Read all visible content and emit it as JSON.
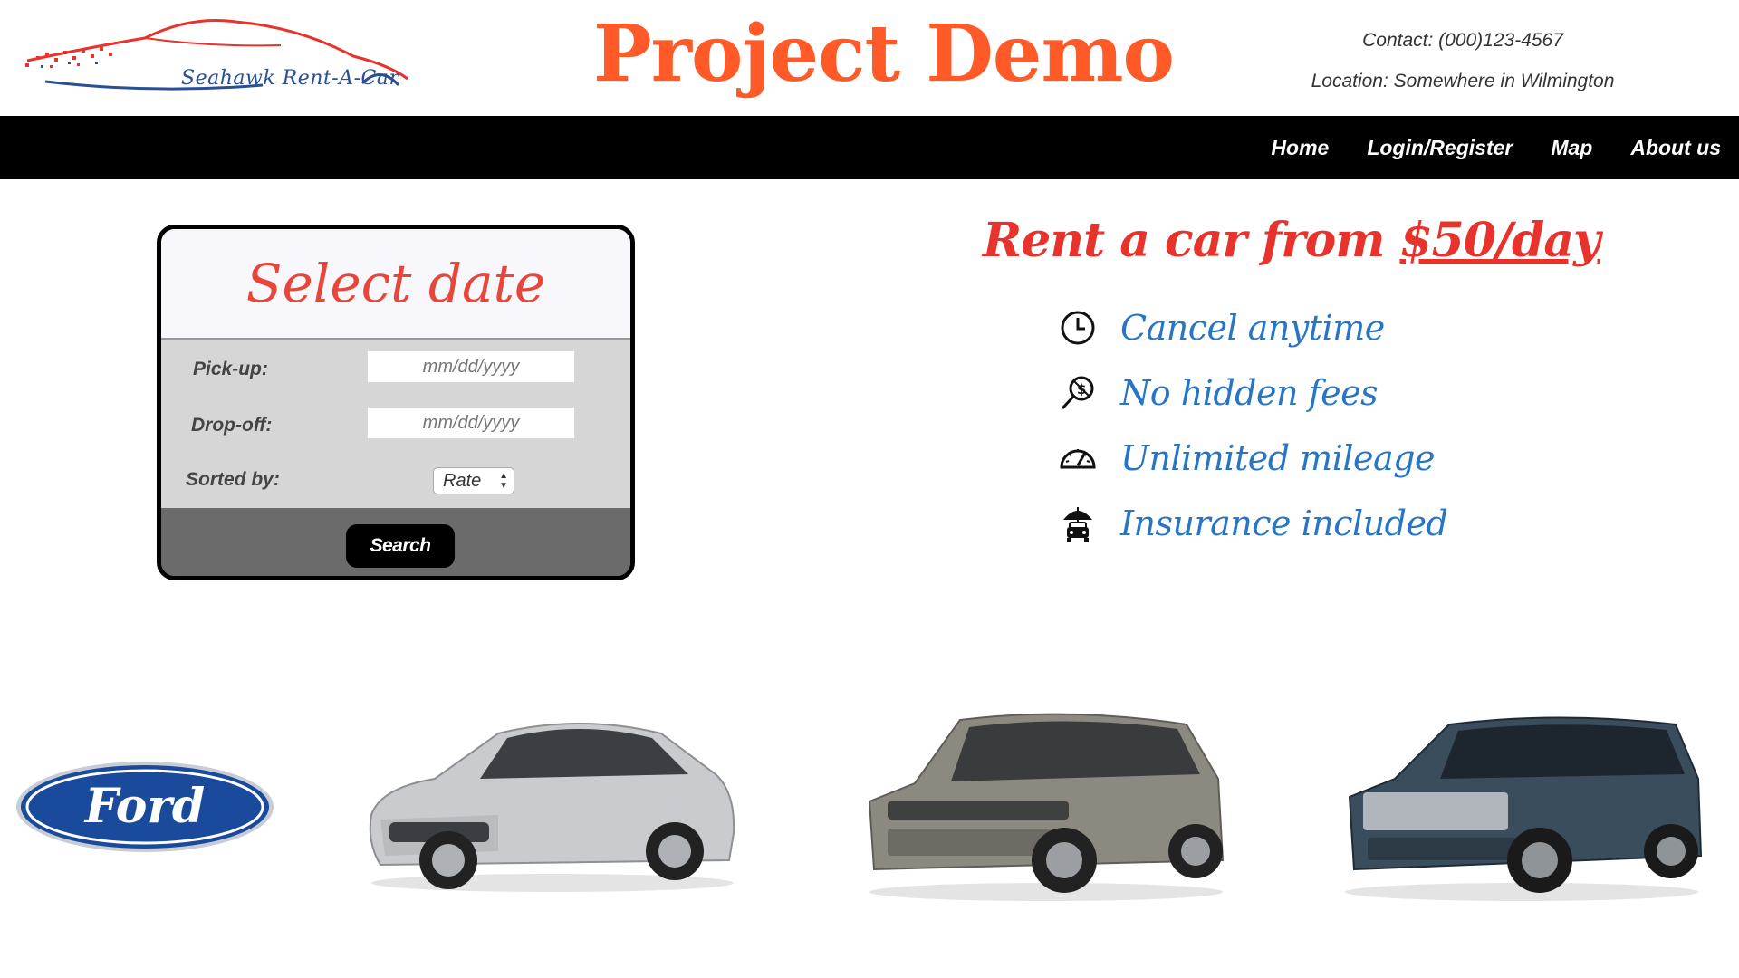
{
  "header": {
    "logo_text": "Seahawk Rent-A-Car",
    "title": "Project Demo",
    "contact": "Contact: (000)123-4567",
    "location": "Location: Somewhere in Wilmington"
  },
  "nav": {
    "items": [
      {
        "label": "Home"
      },
      {
        "label": "Login/Register"
      },
      {
        "label": "Map"
      },
      {
        "label": "About us"
      }
    ]
  },
  "search_panel": {
    "title": "Select date",
    "pickup_label": "Pick-up:",
    "pickup_placeholder": "mm/dd/yyyy",
    "dropoff_label": "Drop-off:",
    "dropoff_placeholder": "mm/dd/yyyy",
    "sort_label": "Sorted by:",
    "sort_value": "Rate",
    "search_button": "Search"
  },
  "promo": {
    "title_prefix": "Rent a car from ",
    "title_price": "$50/day",
    "features": [
      {
        "icon": "clock-icon",
        "text": "Cancel anytime"
      },
      {
        "icon": "no-fees-icon",
        "text": "No hidden fees"
      },
      {
        "icon": "speedometer-icon",
        "text": "Unlimited mileage"
      },
      {
        "icon": "car-insurance-icon",
        "text": "Insurance included"
      }
    ]
  },
  "gallery": {
    "brand_logo": "Ford",
    "cars": [
      {
        "name": "silver-sedan",
        "color": "#c9cbce"
      },
      {
        "name": "grey-suv",
        "color": "#8c8a80"
      },
      {
        "name": "blue-suv",
        "color": "#3a4d5c"
      }
    ]
  },
  "colors": {
    "title_orange": "#ff5a28",
    "promo_red": "#e8332c",
    "feature_blue": "#2775c4",
    "panel_title_red": "#e8463a",
    "nav_bg": "#000000"
  }
}
